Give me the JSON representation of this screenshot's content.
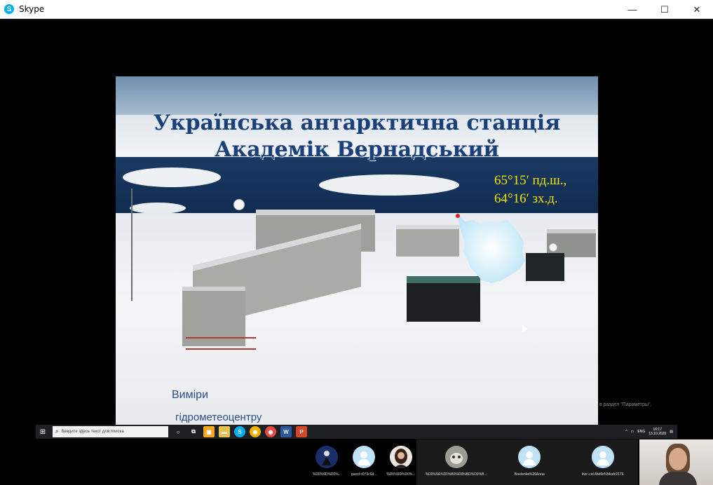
{
  "window": {
    "title": "Skype",
    "controls": {
      "minimize": "—",
      "maximize": "☐",
      "close": "✕"
    }
  },
  "slide": {
    "title_line1": "Українська антарктична станція",
    "title_line2": "Академік Вернадський",
    "coords_line1": "65°15′ пд.ш.,",
    "coords_line2": "64°16′ зх.д.",
    "caption_line1": "Виміри",
    "caption_line2": "гідрометеоцентру"
  },
  "shared_screen": {
    "hint": "в раздел \"Параметры\".",
    "taskbar": {
      "search_placeholder": "Введите здесь текст для поиска",
      "lang": "ENG",
      "time": "16:17",
      "date": "13.10.2020"
    }
  },
  "participants": [
    {
      "name": "%D0%9D%D0%...",
      "avatar": "photo-dark"
    },
    {
      "name": "guest:c073c6d...",
      "avatar": "default"
    },
    {
      "name": "%D0%9D%D0%...",
      "avatar": "photo-woman"
    },
    {
      "name": "%D0%9A%D0%B0%D0%BD%D0%B...",
      "avatar": "photo-cat"
    },
    {
      "name": "Bredenko%20Anna",
      "avatar": "default"
    },
    {
      "name": "live:.cid.4bd9e534edc2176",
      "avatar": "default"
    }
  ],
  "colors": {
    "accent": "#00aff0",
    "title_text": "#1b3f78",
    "coords_text": "#f5e400",
    "avatar_default_bg": "#bfe4f7"
  }
}
